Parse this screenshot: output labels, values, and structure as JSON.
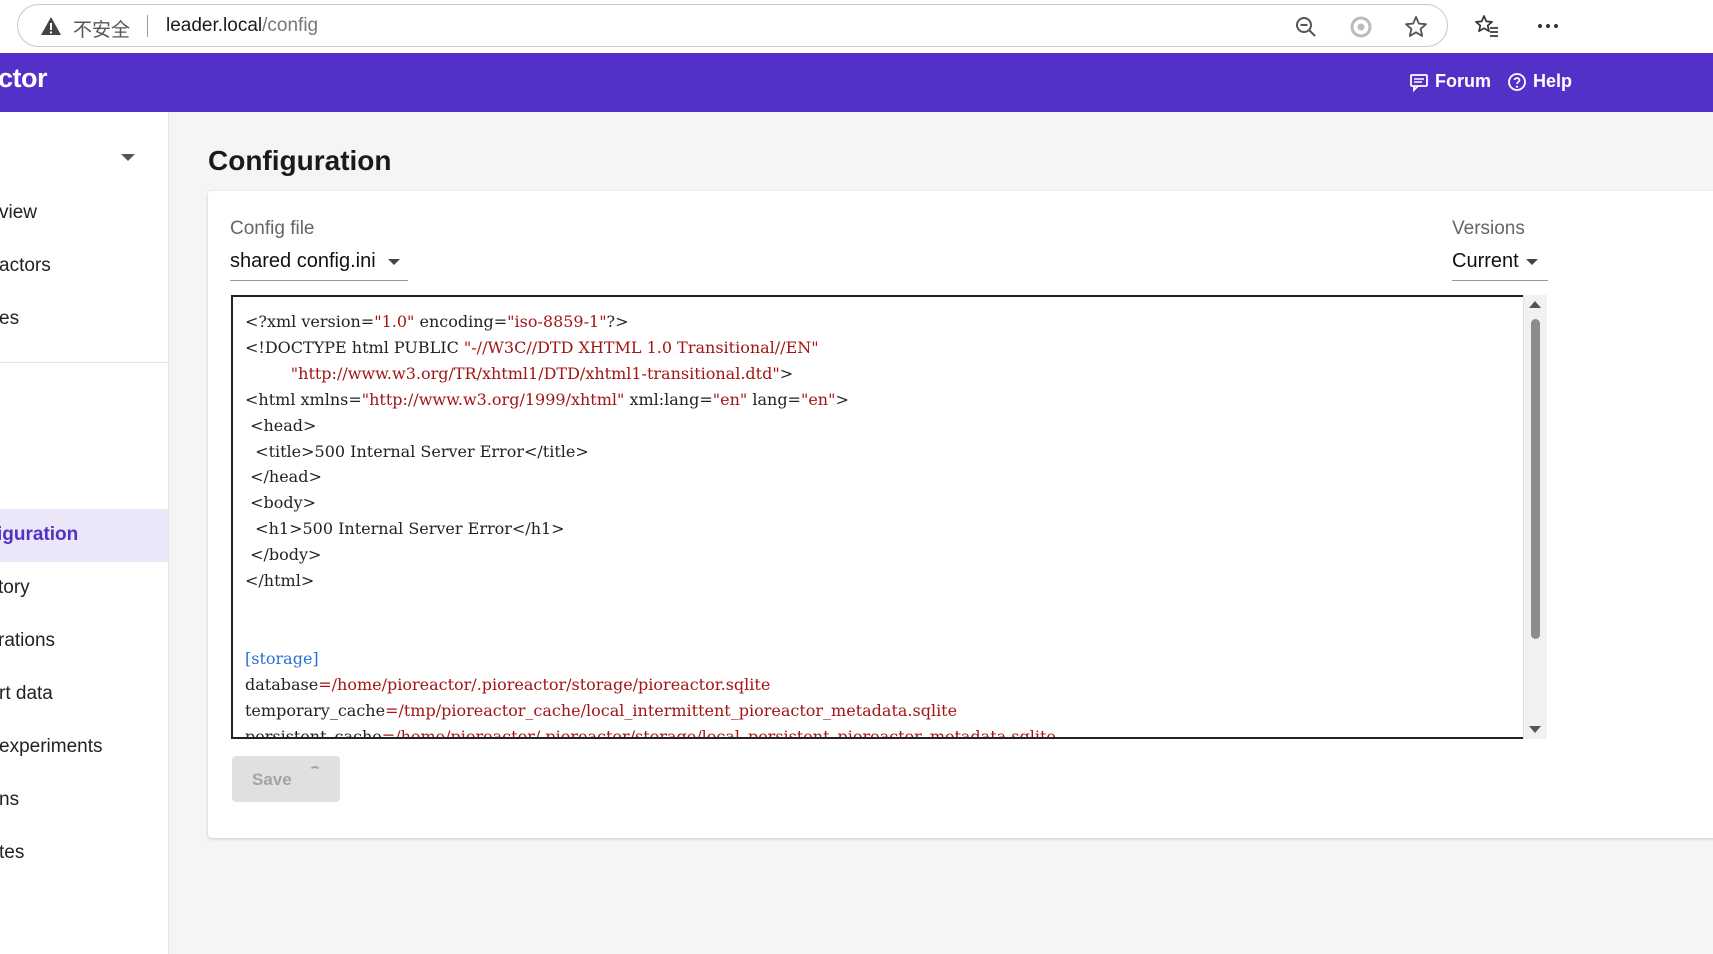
{
  "browser": {
    "security_label": "不安全",
    "url_host": "leader.local",
    "url_path": "/config"
  },
  "header": {
    "brand": "ctor",
    "links": [
      {
        "label": "Forum"
      },
      {
        "label": "Help"
      }
    ],
    "color": "#5331c8"
  },
  "sidebar": {
    "items": [
      {
        "label": "view"
      },
      {
        "label": "actors"
      },
      {
        "label": "es"
      },
      {
        "label": "iguration",
        "active": true
      },
      {
        "label": "tory"
      },
      {
        "label": "rations"
      },
      {
        "label": "rt data"
      },
      {
        "label": "experiments"
      },
      {
        "label": "ns"
      },
      {
        "label": "tes"
      }
    ]
  },
  "main": {
    "title": "Configuration",
    "config_file": {
      "label": "Config file",
      "value": "shared config.ini"
    },
    "versions": {
      "label": "Versions",
      "value": "Current"
    },
    "code_lines": [
      "<?xml version=\"1.0\" encoding=\"iso-8859-1\"?>",
      "<!DOCTYPE html PUBLIC \"-//W3C//DTD XHTML 1.0 Transitional//EN\"",
      "         \"http://www.w3.org/TR/xhtml1/DTD/xhtml1-transitional.dtd\">",
      "<html xmlns=\"http://www.w3.org/1999/xhtml\" xml:lang=\"en\" lang=\"en\">",
      " <head>",
      "  <title>500 Internal Server Error</title>",
      " </head>",
      " <body>",
      "  <h1>500 Internal Server Error</h1>",
      " </body>",
      "</html>",
      "",
      "",
      "[storage]",
      "database=/home/pioreactor/.pioreactor/storage/pioreactor.sqlite",
      "temporary_cache=/tmp/pioreactor_cache/local_intermittent_pioreactor_metadata.sqlite",
      "persistent_cache=/home/pioreactor/.pioreactor/storage/local_persistent_pioreactor_metadata.sqlite"
    ],
    "save_label": "Save"
  }
}
